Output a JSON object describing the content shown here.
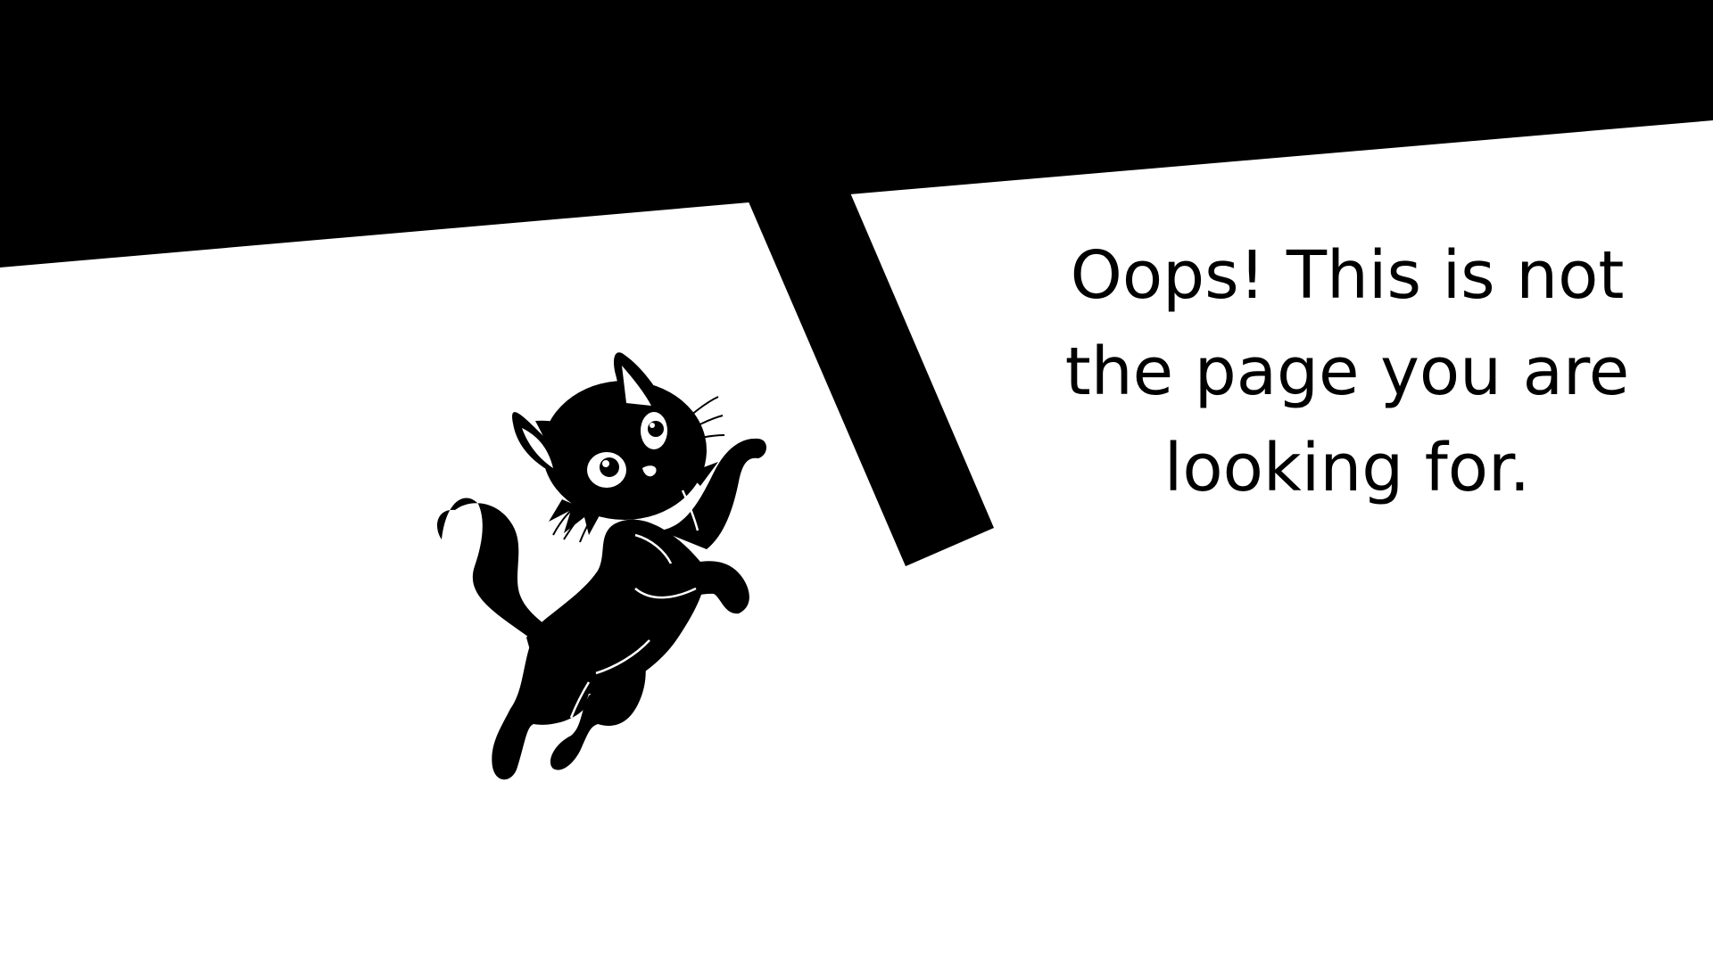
{
  "error_message": {
    "line_1": "Oops! This is not",
    "line_2": "the page you are",
    "line_3": "looking for."
  },
  "illustration": {
    "icon": "jumping-black-cat-icon",
    "colors": {
      "background": "#ffffff",
      "ink": "#000000"
    }
  }
}
